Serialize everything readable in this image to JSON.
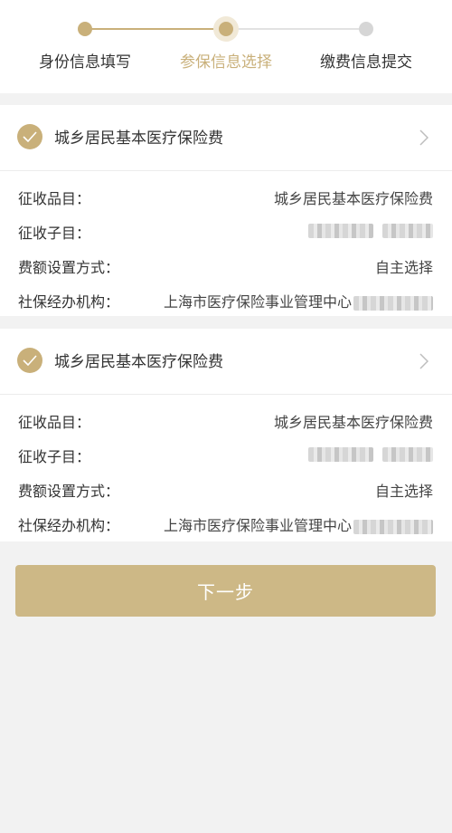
{
  "stepper": {
    "steps": [
      {
        "label": "身份信息填写",
        "state": "done"
      },
      {
        "label": "参保信息选择",
        "state": "current"
      },
      {
        "label": "缴费信息提交",
        "state": "todo"
      }
    ]
  },
  "cards": [
    {
      "title": "城乡居民基本医疗保险费",
      "rows": [
        {
          "label": "征收品目：",
          "value": "城乡居民基本医疗保险费"
        },
        {
          "label": "征收子目：",
          "value": ""
        },
        {
          "label": "费额设置方式：",
          "value": "自主选择"
        },
        {
          "label": "社保经办机构：",
          "value": "上海市医疗保险事业管理中心"
        }
      ]
    },
    {
      "title": "城乡居民基本医疗保险费",
      "rows": [
        {
          "label": "征收品目：",
          "value": "城乡居民基本医疗保险费"
        },
        {
          "label": "征收子目：",
          "value": ""
        },
        {
          "label": "费额设置方式：",
          "value": "自主选择"
        },
        {
          "label": "社保经办机构：",
          "value": "上海市医疗保险事业管理中心"
        }
      ]
    }
  ],
  "next_button": {
    "label": "下一步"
  },
  "colors": {
    "accent": "#c9b07a",
    "button": "#cdb886",
    "background": "#f2f2f2"
  }
}
